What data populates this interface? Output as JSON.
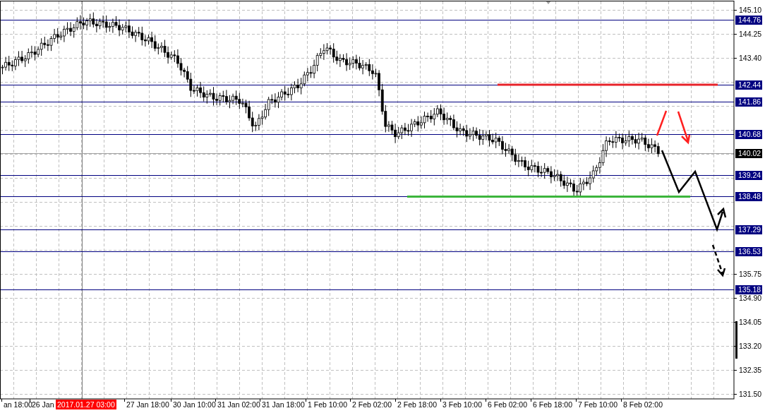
{
  "price_axis": {
    "ticks": [
      "145.10",
      "144.25",
      "143.40",
      "135.75",
      "134.90",
      "134.05",
      "133.20",
      "132.35",
      "131.50"
    ]
  },
  "levels": [
    {
      "price": "144.76",
      "kind": "level"
    },
    {
      "price": "142.44",
      "kind": "level"
    },
    {
      "price": "141.86",
      "kind": "level"
    },
    {
      "price": "140.68",
      "kind": "level"
    },
    {
      "price": "140.02",
      "kind": "current"
    },
    {
      "price": "139.24",
      "kind": "level"
    },
    {
      "price": "138.48",
      "kind": "level"
    },
    {
      "price": "137.29",
      "kind": "level"
    },
    {
      "price": "136.53",
      "kind": "level"
    },
    {
      "price": "135.18",
      "kind": "level"
    }
  ],
  "time_axis": {
    "labels": [
      "an 18:00",
      "26 Jan",
      "27 Jan 18:00",
      "30 Jan 10:00",
      "31 Jan 02:00",
      "31 Jan 18:00",
      "1 Feb 10:00",
      "2 Feb 02:00",
      "2 Feb 18:00",
      "3 Feb 10:00",
      "6 Feb 02:00",
      "6 Feb 18:00",
      "7 Feb 10:00",
      "8 Feb 02:00"
    ]
  },
  "crosshair": {
    "time": "2017.01.27 03:00"
  }
}
